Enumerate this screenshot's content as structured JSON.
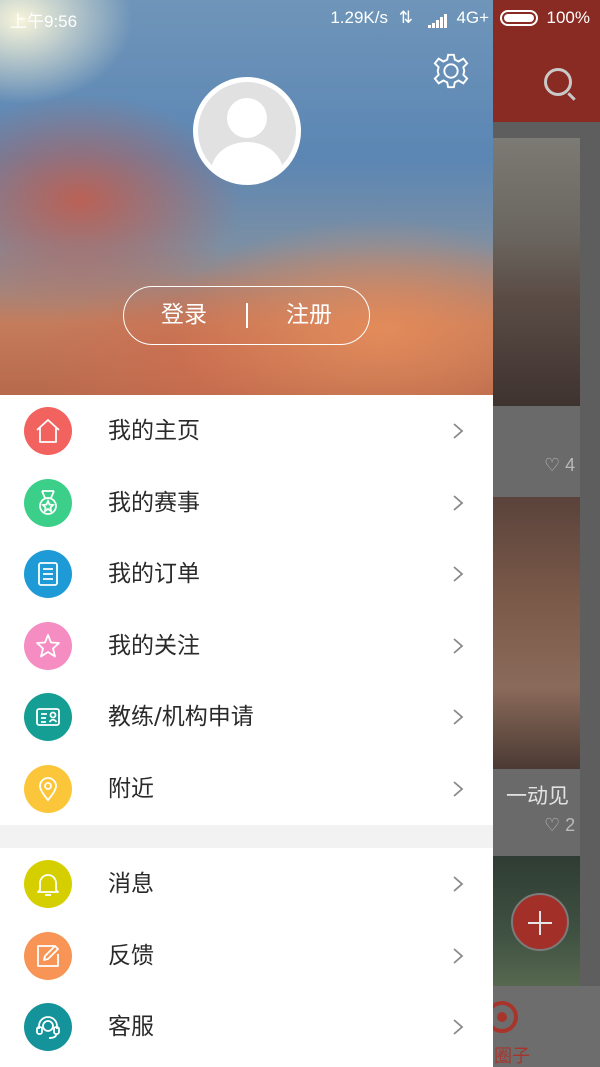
{
  "status": {
    "time": "上午9:56",
    "net_speed": "1.29K/s",
    "network": "4G+",
    "battery": "100%"
  },
  "auth": {
    "login": "登录",
    "register": "注册"
  },
  "menu": [
    {
      "label": "我的主页",
      "icon": "home-icon",
      "color": "#f2625e"
    },
    {
      "label": "我的赛事",
      "icon": "medal-icon",
      "color": "#3ccf8a"
    },
    {
      "label": "我的订单",
      "icon": "order-list-icon",
      "color": "#1e9bd6"
    },
    {
      "label": "我的关注",
      "icon": "star-icon",
      "color": "#f58dc2"
    },
    {
      "label": "教练/机构申请",
      "icon": "id-card-icon",
      "color": "#149e94"
    },
    {
      "label": "附近",
      "icon": "location-pin-icon",
      "color": "#fcc63a"
    },
    {
      "label": "消息",
      "icon": "bell-icon",
      "color": "#d6cf00"
    },
    {
      "label": "反馈",
      "icon": "edit-icon",
      "color": "#f89556"
    },
    {
      "label": "客服",
      "icon": "headset-icon",
      "color": "#15939a"
    }
  ],
  "background_app": {
    "like_count_1": "4",
    "like_count_2": "2",
    "card_title_fragment": "一动见",
    "bottom_nav_label_fragment": "圈子"
  }
}
